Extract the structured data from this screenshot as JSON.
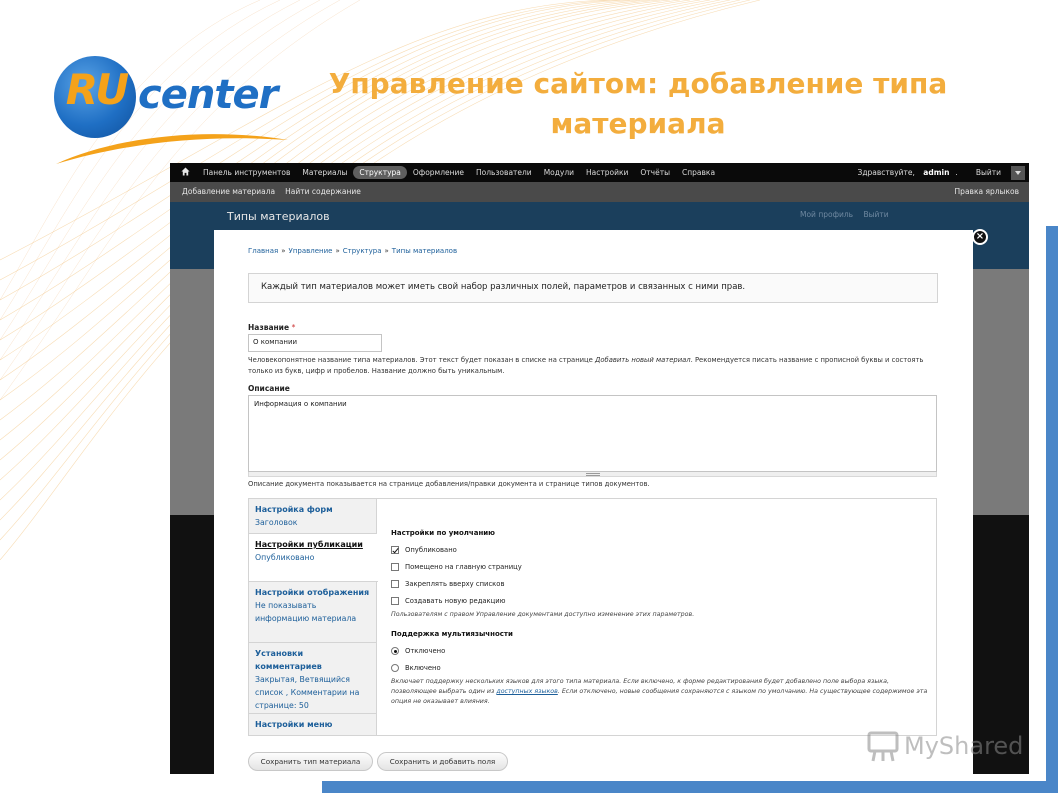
{
  "slide": {
    "title": "Управление сайтом: добавление типа материала",
    "logo": {
      "ru": "RU",
      "center": "center"
    },
    "watermark": "MyShared"
  },
  "toolbar": {
    "items": [
      "Панель инструментов",
      "Материалы",
      "Структура",
      "Оформление",
      "Пользователи",
      "Модули",
      "Настройки",
      "Отчёты",
      "Справка"
    ],
    "active_item": "Структура",
    "greeting_prefix": "Здравствуйте, ",
    "greeting_user": "admin",
    "greeting_suffix": ".",
    "logout": "Выйти"
  },
  "shortcuts": {
    "items": [
      "Добавление материала",
      "Найти содержание"
    ],
    "edit": "Правка ярлыков"
  },
  "background_page": {
    "title": "Типы материалов",
    "links": [
      "Мой профиль",
      "Выйти"
    ]
  },
  "overlay": {
    "breadcrumb": [
      "Главная",
      "Управление",
      "Структура",
      "Типы материалов"
    ],
    "help_text": "Каждый тип материалов может иметь свой набор различных полей, параметров и связанных с ними прав.",
    "name": {
      "label": "Название",
      "required_mark": "*",
      "value": "О компании",
      "desc_before": "Человекопонятное название типа материалов. Этот текст будет показан в списке на странице ",
      "desc_italic": "Добавить новый материал",
      "desc_after": ". Рекомендуется писать название с прописной буквы и состоять только из букв, цифр и пробелов. Название должно быть уникальным."
    },
    "description": {
      "label": "Описание",
      "value": "Информация о компании",
      "help": "Описание документа показывается на странице добавления/правки документа и странице типов документов."
    },
    "vtabs": [
      {
        "title": "Настройка форм",
        "summary": "Заголовок"
      },
      {
        "title": "Настройки публикации",
        "summary": "Опубликовано"
      },
      {
        "title": "Настройки отображения",
        "summary": "Не показывать информацию материала"
      },
      {
        "title": "Установки комментариев",
        "summary": "Закрытая, Ветвящийся список , Комментарии на странице: 50"
      },
      {
        "title": "Настройки меню",
        "summary": ""
      }
    ],
    "active_tab": 1,
    "panel": {
      "defaults_heading": "Настройки по умолчанию",
      "options": [
        {
          "label": "Опубликовано",
          "checked": true
        },
        {
          "label": "Помещено на главную страницу",
          "checked": false
        },
        {
          "label": "Закреплять вверху списков",
          "checked": false
        },
        {
          "label": "Создавать новую редакцию",
          "checked": false
        }
      ],
      "defaults_note": "Пользователям с правом Управление документами доступно изменение этих параметров.",
      "multilang_heading": "Поддержка мультиязычности",
      "radios": [
        {
          "label": "Отключено",
          "checked": true
        },
        {
          "label": "Включено",
          "checked": false
        }
      ],
      "multilang_note_1": "Включает поддержку нескольких языков для этого типа материала. Если включено, к форме редактирования будет добавлено поле выбора языка, позволяющее выбрать один из ",
      "multilang_note_link": "доступных языков",
      "multilang_note_2": ". Если отключено, новые сообщения сохраняются с языком по умолчанию. На существующее содержимое эта опция не оказывает влияния."
    },
    "buttons": {
      "save": "Сохранить тип материала",
      "save_fields": "Сохранить и добавить поля"
    }
  },
  "colors": {
    "slide_title": "#f3ad3d",
    "accent": "#4a86c8",
    "link": "#1d5f9a",
    "toolbar_bg": "#0a0a0a"
  }
}
